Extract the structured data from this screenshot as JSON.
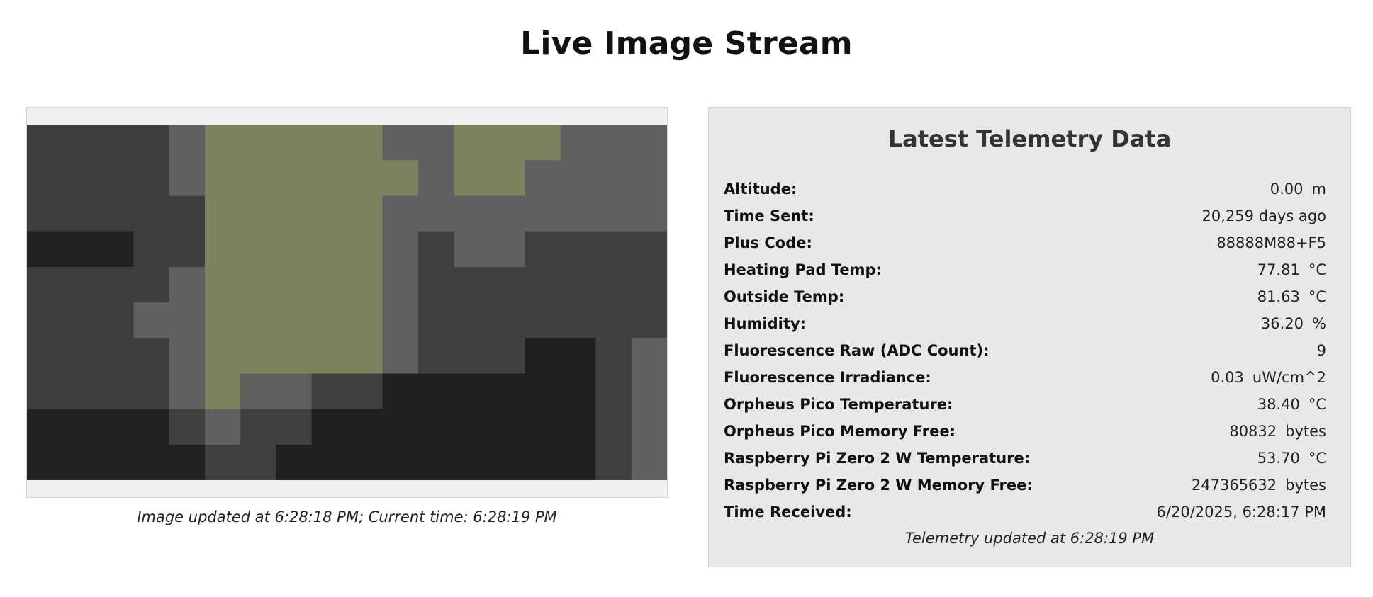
{
  "page": {
    "title": "Live Image Stream"
  },
  "image_panel": {
    "caption": "Image updated at 6:28:18 PM; Current time: 6:28:19 PM",
    "palette": {
      "dark": "#3e3e3e",
      "mid": "#606060",
      "black": "#222222",
      "olive": "#7e815e",
      "darker": "#404040",
      "nearblack": "#21221f"
    }
  },
  "telemetry": {
    "title": "Latest Telemetry Data",
    "rows": [
      {
        "label": "Altitude:",
        "value": "0.00",
        "unit": "m"
      },
      {
        "label": "Time Sent:",
        "value": "20,259 days ago",
        "unit": ""
      },
      {
        "label": "Plus Code:",
        "value": "88888M88+F5",
        "unit": ""
      },
      {
        "label": "Heating Pad Temp:",
        "value": "77.81",
        "unit": "°C"
      },
      {
        "label": "Outside Temp:",
        "value": "81.63",
        "unit": "°C"
      },
      {
        "label": "Humidity:",
        "value": "36.20",
        "unit": "%"
      },
      {
        "label": "Fluorescence Raw (ADC Count):",
        "value": "9",
        "unit": ""
      },
      {
        "label": "Fluorescence Irradiance:",
        "value": "0.03",
        "unit": "uW/cm^2"
      },
      {
        "label": "Orpheus Pico Temperature:",
        "value": "38.40",
        "unit": "°C"
      },
      {
        "label": "Orpheus Pico Memory Free:",
        "value": "80832",
        "unit": "bytes"
      },
      {
        "label": "Raspberry Pi Zero 2 W Temperature:",
        "value": "53.70",
        "unit": "°C"
      },
      {
        "label": "Raspberry Pi Zero 2 W Memory Free:",
        "value": "247365632",
        "unit": "bytes"
      },
      {
        "label": "Time Received:",
        "value": "6/20/2025, 6:28:17 PM",
        "unit": ""
      }
    ],
    "footer": "Telemetry updated at 6:28:19 PM"
  }
}
